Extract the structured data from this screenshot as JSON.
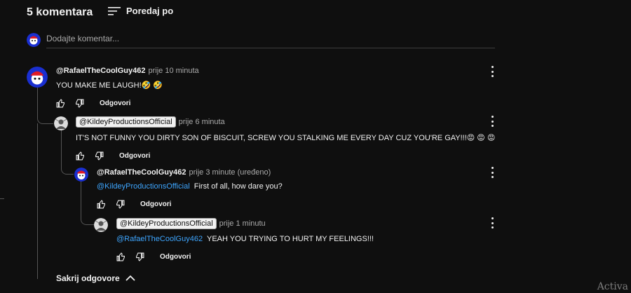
{
  "header": {
    "count_label": "5 komentara",
    "sort_label": "Poredaj po",
    "sort_icon": "sort-icon"
  },
  "add_comment": {
    "placeholder": "Dodajte komentar..."
  },
  "comments": [
    {
      "author": "@RafaelTheCoolGuy462",
      "time": "prije 10 minuta",
      "text": "YOU MAKE ME LAUGH!🤣 🤣",
      "reply_label": "Odgovori"
    },
    {
      "author": "@KildeyProductionsOfficial",
      "time": "prije 6 minuta",
      "text": "IT'S NOT FUNNY YOU DIRTY SON OF BISCUIT, SCREW YOU STALKING ME EVERY DAY CUZ YOU'RE GAY!!!😡 😡 😡",
      "reply_label": "Odgovori"
    },
    {
      "author": "@RafaelTheCoolGuy462",
      "time": "prije 3 minute (uređeno)",
      "mention": "@KildeyProductionsOfficial",
      "text": "First of all, how dare you?",
      "reply_label": "Odgovori"
    },
    {
      "author": "@KildeyProductionsOfficial",
      "time": "prije 1 minutu",
      "mention": "@RafaelTheCoolGuy462",
      "text": "YEAH YOU TRYING TO HURT MY FEELINGS!!!",
      "reply_label": "Odgovori"
    }
  ],
  "hide_replies_label": "Sakrij odgovore",
  "watermark": "Activa",
  "colors": {
    "background": "#0f0f0f",
    "text": "#f1f1f1",
    "secondary": "#aaaaaa",
    "mention": "#3ea6ff"
  }
}
